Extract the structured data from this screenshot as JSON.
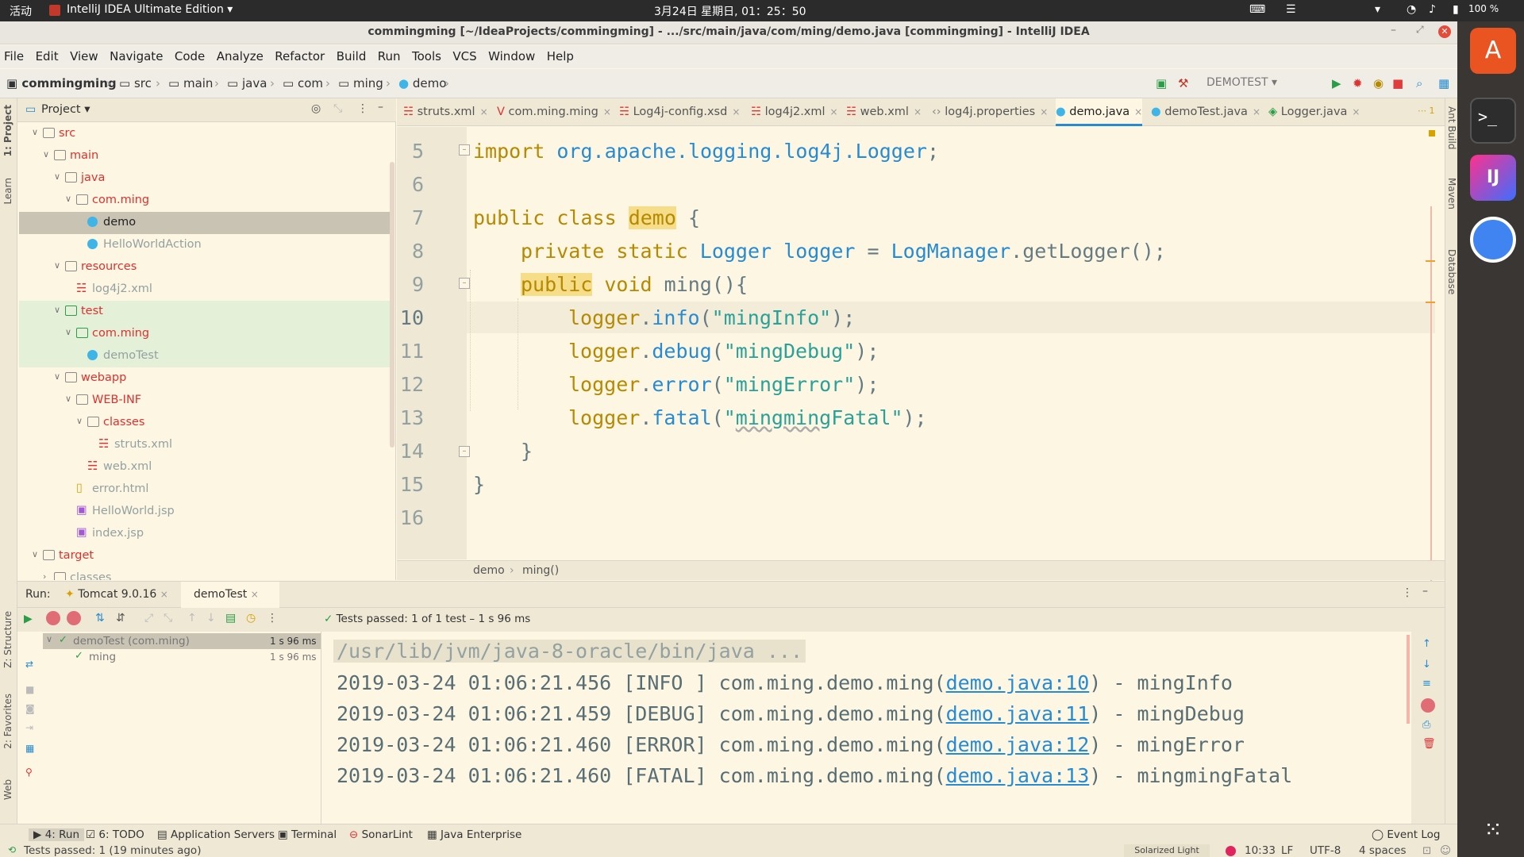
{
  "top_panel": {
    "activities": "活动",
    "app_name": "IntelliJ IDEA Ultimate Edition",
    "clock": "3月24日 星期日, 01：25：50",
    "battery": "100 %"
  },
  "window": {
    "title": "commingming [~/IdeaProjects/commingming] - .../src/main/java/com/ming/demo.java [commingming] - IntelliJ IDEA"
  },
  "menu": [
    "File",
    "Edit",
    "View",
    "Navigate",
    "Code",
    "Analyze",
    "Refactor",
    "Build",
    "Run",
    "Tools",
    "VCS",
    "Window",
    "Help"
  ],
  "breadcrumb": [
    "commingming",
    "src",
    "main",
    "java",
    "com",
    "ming",
    "demo"
  ],
  "run_config": "DEMOTEST",
  "project_panel": {
    "title": "Project",
    "tree": [
      {
        "label": "src",
        "depth": 0,
        "open": true,
        "type": "folder",
        "color": "#dc322f"
      },
      {
        "label": "main",
        "depth": 1,
        "open": true,
        "type": "folder",
        "color": "#dc322f"
      },
      {
        "label": "java",
        "depth": 2,
        "open": true,
        "type": "folder",
        "color": "#dc322f"
      },
      {
        "label": "com.ming",
        "depth": 3,
        "open": true,
        "type": "folder",
        "color": "#dc322f"
      },
      {
        "label": "demo",
        "depth": 4,
        "type": "class",
        "color": "#222222",
        "selected": true
      },
      {
        "label": "HelloWorldAction",
        "depth": 4,
        "type": "class",
        "color": "#93a1a1"
      },
      {
        "label": "resources",
        "depth": 2,
        "open": true,
        "type": "folder",
        "color": "#dc322f"
      },
      {
        "label": "log4j2.xml",
        "depth": 3,
        "type": "xml",
        "color": "#93a1a1"
      },
      {
        "label": "test",
        "depth": 2,
        "open": true,
        "type": "folder",
        "color": "#dc322f",
        "green": true
      },
      {
        "label": "com.ming",
        "depth": 3,
        "open": true,
        "type": "folder",
        "color": "#dc322f",
        "green": true
      },
      {
        "label": "demoTest",
        "depth": 4,
        "type": "class",
        "color": "#93a1a1",
        "green": true
      },
      {
        "label": "webapp",
        "depth": 2,
        "open": true,
        "type": "folder",
        "color": "#dc322f"
      },
      {
        "label": "WEB-INF",
        "depth": 3,
        "open": true,
        "type": "folder",
        "color": "#dc322f"
      },
      {
        "label": "classes",
        "depth": 4,
        "open": true,
        "type": "folder",
        "color": "#dc322f"
      },
      {
        "label": "struts.xml",
        "depth": 5,
        "type": "xml",
        "color": "#93a1a1"
      },
      {
        "label": "web.xml",
        "depth": 4,
        "type": "xml",
        "color": "#93a1a1"
      },
      {
        "label": "error.html",
        "depth": 3,
        "type": "html",
        "color": "#93a1a1"
      },
      {
        "label": "HelloWorld.jsp",
        "depth": 3,
        "type": "jsp",
        "color": "#93a1a1"
      },
      {
        "label": "index.jsp",
        "depth": 3,
        "type": "jsp",
        "color": "#93a1a1"
      },
      {
        "label": "target",
        "depth": 0,
        "open": true,
        "type": "folder",
        "color": "#dc322f"
      },
      {
        "label": "classes",
        "depth": 1,
        "open": false,
        "type": "folder",
        "color": "#93a1a1"
      }
    ]
  },
  "editor_tabs": [
    "struts.xml",
    "com.ming.ming",
    "Log4j-config.xsd",
    "log4j2.xml",
    "web.xml",
    "log4j.properties",
    "demo.java",
    "demoTest.java",
    "Logger.java"
  ],
  "active_tab": "demo.java",
  "editor": {
    "line_numbers": [
      "5",
      "6",
      "7",
      "8",
      "9",
      "10",
      "11",
      "12",
      "13",
      "14",
      "15",
      "16"
    ],
    "crumb": [
      "demo",
      "ming()"
    ]
  },
  "run": {
    "label": "Run:",
    "tabs": [
      "Tomcat 9.0.16",
      "demoTest"
    ],
    "status": "Tests passed: 1 of 1 test – 1 s 96 ms",
    "tests": [
      {
        "name": "demoTest (com.ming)",
        "time": "1 s 96 ms"
      },
      {
        "name": "ming",
        "time": "1 s 96 ms"
      }
    ],
    "console": [
      {
        "text": "/usr/lib/jvm/java-8-oracle/bin/java ...",
        "link": "",
        "tail": ""
      },
      {
        "text": "2019-03-24 01:06:21.456 [INFO ] com.ming.demo.ming(",
        "link": "demo.java:10",
        "tail": ") - mingInfo"
      },
      {
        "text": "2019-03-24 01:06:21.459 [DEBUG] com.ming.demo.ming(",
        "link": "demo.java:11",
        "tail": ") - mingDebug"
      },
      {
        "text": "2019-03-24 01:06:21.460 [ERROR] com.ming.demo.ming(",
        "link": "demo.java:12",
        "tail": ") - mingError"
      },
      {
        "text": "2019-03-24 01:06:21.460 [FATAL] com.ming.demo.ming(",
        "link": "demo.java:13",
        "tail": ") - mingmingFatal"
      }
    ]
  },
  "tool_windows": [
    "4: Run",
    "6: TODO",
    "Application Servers",
    "Terminal",
    "SonarLint",
    "Java Enterprise"
  ],
  "event_log": "Event Log",
  "status": {
    "message": "Tests passed: 1 (19 minutes ago)",
    "theme": "Solarized Light",
    "position": "10:33",
    "line_sep": "LF",
    "encoding": "UTF-8",
    "indent": "4 spaces"
  },
  "side_labels": {
    "project": "1: Project",
    "learn": "Learn",
    "structure": "Z: Structure",
    "favorites": "2: Favorites",
    "web": "Web",
    "ant": "Ant Build",
    "maven": "Maven",
    "database": "Database"
  },
  "colors": {
    "bg": "#fdf6e3",
    "panel": "#eee8d5",
    "keyword": "#b58900",
    "type": "#268bd2",
    "string": "#2aa198",
    "folder_red": "#dc322f"
  }
}
